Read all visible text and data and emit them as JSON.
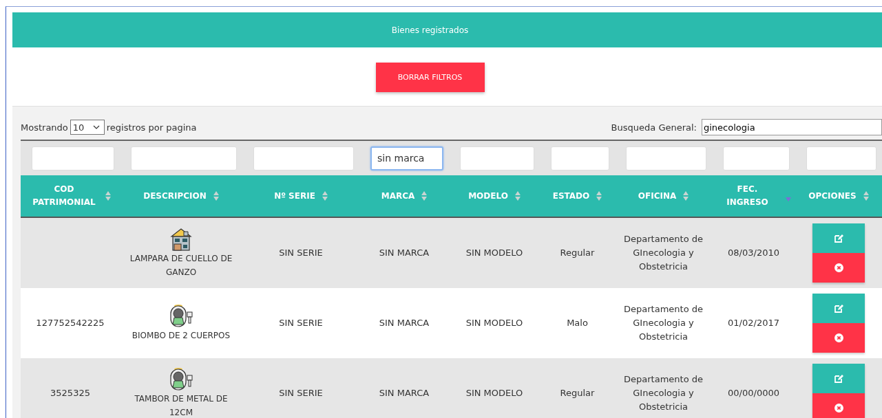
{
  "panel": {
    "title": "Bienes registrados"
  },
  "clear_button": "BORRAR FILTROS",
  "length": {
    "before": "Mostrando",
    "value": "10",
    "after": "registros por pagina"
  },
  "search": {
    "label": "Busqueda General:",
    "value": "ginecologia"
  },
  "filters": [
    {
      "focused": false
    },
    {
      "focused": false
    },
    {
      "focused": false
    },
    {
      "value": "sin marca",
      "focused": true
    },
    {
      "focused": false
    },
    {
      "focused": false
    },
    {
      "focused": false
    },
    {
      "focused": false
    },
    {
      "focused": false
    }
  ],
  "columns": [
    {
      "label": "COD PATRIMONIAL",
      "sorted": false
    },
    {
      "label": "DESCRIPCION",
      "sorted": false
    },
    {
      "label": "Nº SERIE",
      "sorted": false
    },
    {
      "label": "MARCA",
      "sorted": false
    },
    {
      "label": "MODELO",
      "sorted": false
    },
    {
      "label": "ESTADO",
      "sorted": false
    },
    {
      "label": "OFICINA",
      "sorted": false
    },
    {
      "label": "FEC. INGRESO",
      "sorted": true
    },
    {
      "label": "OPCIONES",
      "sorted": false
    }
  ],
  "rows": [
    {
      "kind": "house",
      "descripcion": "LAMPARA DE CUELLO DE GANZO",
      "serie": "SIN SERIE",
      "marca": "SIN MARCA",
      "modelo": "SIN MODELO",
      "estado": "Regular",
      "oficina": "Departamento de GInecologia y Obstetricia",
      "fecha": "08/03/2010"
    },
    {
      "cod": "127752542225",
      "kind": "scanner",
      "descripcion": "BIOMBO DE 2 CUERPOS",
      "serie": "SIN SERIE",
      "marca": "SIN MARCA",
      "modelo": "SIN MODELO",
      "estado": "Malo",
      "oficina": "Departamento de GInecologia y Obstetricia",
      "fecha": "01/02/2017"
    },
    {
      "cod": "3525325",
      "kind": "scanner",
      "descripcion": "TAMBOR DE METAL DE 12CM",
      "serie": "SIN SERIE",
      "marca": "SIN MARCA",
      "modelo": "SIN MODELO",
      "estado": "Regular",
      "oficina": "Departamento de GInecologia y Obstetricia",
      "fecha": "00/00/0000"
    }
  ]
}
